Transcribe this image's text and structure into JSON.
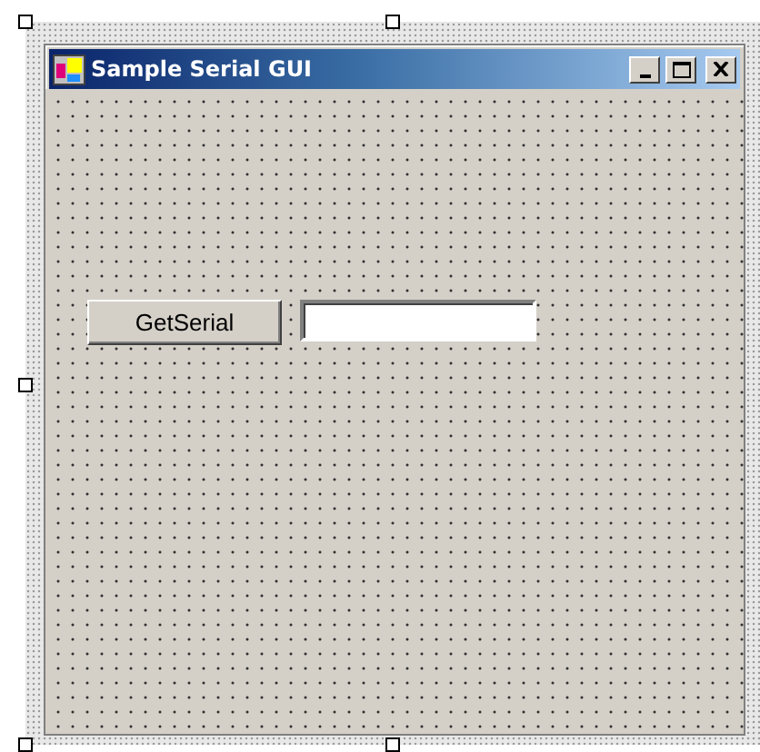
{
  "window": {
    "title": "Sample Serial GUI"
  },
  "controls": [
    {
      "kind": "button",
      "label": "GetSerial"
    },
    {
      "kind": "textbox"
    }
  ]
}
